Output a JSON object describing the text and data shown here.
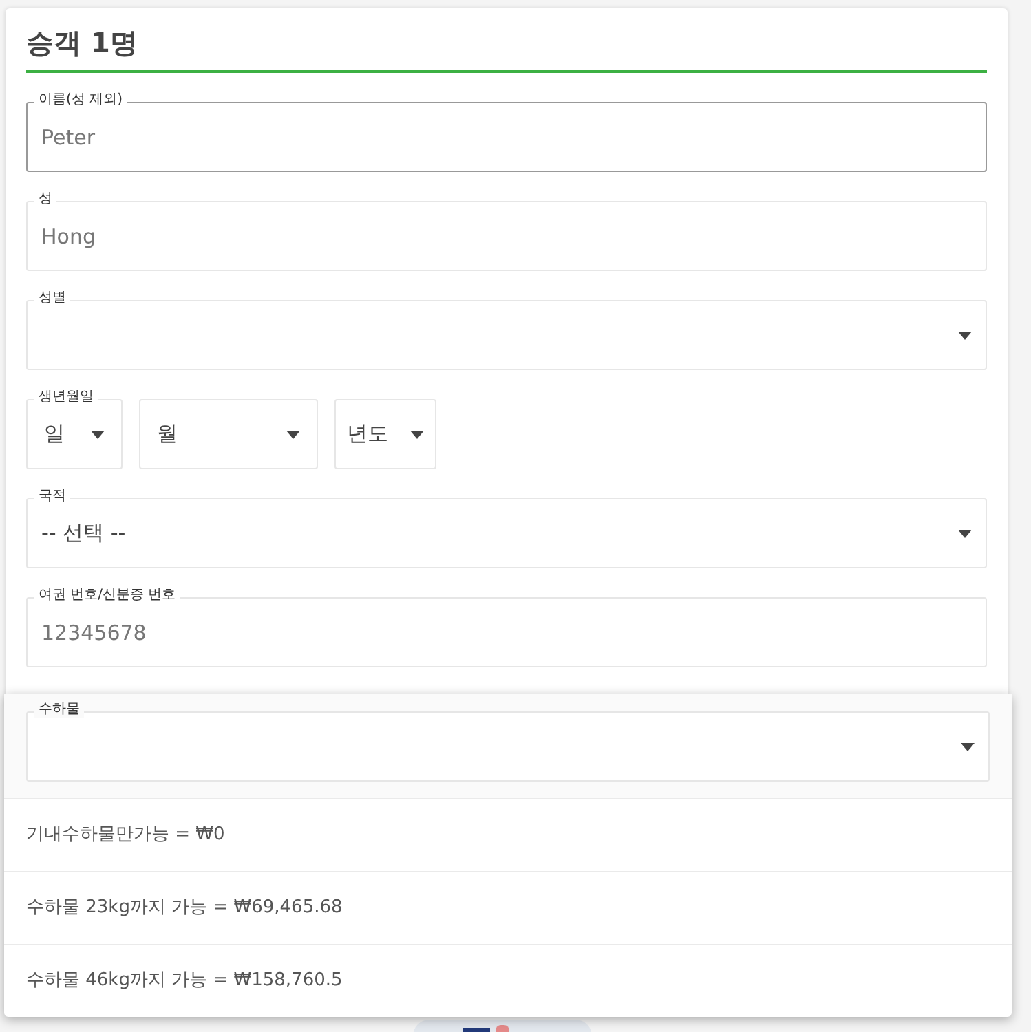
{
  "heading": "승객 1명",
  "fields": [
    {
      "kind": "text",
      "label": "이름(성 제외)",
      "value": "Peter",
      "focused": true
    },
    {
      "kind": "text",
      "label": "성",
      "value": "Hong",
      "focused": false
    },
    {
      "kind": "select",
      "label": "성별",
      "focused": false
    },
    {
      "kind": "date",
      "label": "생년월일",
      "parts": [
        "일",
        "월",
        "년도"
      ]
    },
    {
      "kind": "select",
      "label": "국적",
      "value": "-- 선택 --",
      "focused": false
    },
    {
      "kind": "text",
      "label": "여권 번호/신분증 번호",
      "value": "12345678",
      "focused": false
    }
  ],
  "baggage": {
    "label": "수하물",
    "options": [
      "기내수하물만가능 = ₩0",
      "수하물 23kg까지 가능 = ₩69,465.68",
      "수하물 46kg까지 가능 = ₩158,760.5"
    ]
  }
}
